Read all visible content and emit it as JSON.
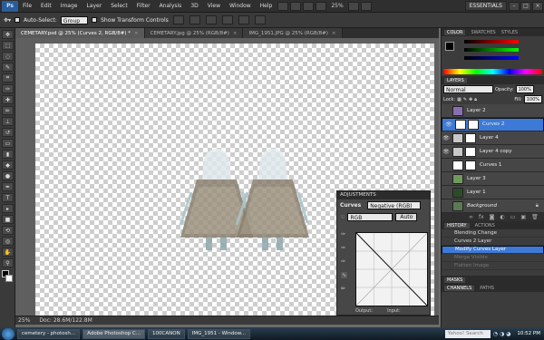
{
  "menubar": {
    "logo": "Ps",
    "items": [
      "File",
      "Edit",
      "Image",
      "Layer",
      "Select",
      "Filter",
      "Analysis",
      "3D",
      "View",
      "Window",
      "Help"
    ],
    "zoom": "25%",
    "workspace": "ESSENTIALS"
  },
  "options": {
    "auto_select_label": "Auto-Select:",
    "auto_select_value": "Group",
    "transform_label": "Show Transform Controls"
  },
  "tabs": [
    {
      "label": "CEMETARY.psd @ 25% (Curves 2, RGB/8#) *",
      "active": true
    },
    {
      "label": "CEMETARY.jpg @ 25% (RGB/8#)",
      "active": false
    },
    {
      "label": "IMG_1951.JPG @ 25% (RGB/8#)",
      "active": false
    }
  ],
  "status": {
    "zoom": "25%",
    "doc": "Doc: 28.6M/122.8M"
  },
  "adjustments": {
    "title": "ADJUSTMENTS",
    "curves_label": "Curves",
    "preset": "Negative (RGB)",
    "channel": "RGB",
    "auto": "Auto",
    "output": "Output:",
    "input": "Input:"
  },
  "panels": {
    "color_tabs": [
      "COLOR",
      "SWATCHES",
      "STYLES"
    ],
    "layers_tabs": [
      "LAYERS"
    ],
    "blend_mode": "Normal",
    "opacity_label": "Opacity:",
    "opacity": "100%",
    "lock_label": "Lock:",
    "fill_label": "Fill:",
    "fill": "100%",
    "layers": [
      {
        "name": "Layer 2",
        "visible": false,
        "selected": false,
        "thumb": "#8a6fb0",
        "mask": false
      },
      {
        "name": "Curves 2",
        "visible": true,
        "selected": true,
        "thumb": "#ffffff",
        "mask": true
      },
      {
        "name": "Layer 4",
        "visible": true,
        "selected": false,
        "thumb": "#c8c8c8",
        "mask": true
      },
      {
        "name": "Layer 4 copy",
        "visible": true,
        "selected": false,
        "thumb": "#c8c8c8",
        "mask": true
      },
      {
        "name": "Curves 1",
        "visible": false,
        "selected": false,
        "thumb": "#ffffff",
        "mask": true
      },
      {
        "name": "Layer 3",
        "visible": false,
        "selected": false,
        "thumb": "#6f9a5c",
        "mask": false
      },
      {
        "name": "Layer 1",
        "visible": false,
        "selected": false,
        "thumb": "#2e4a2a",
        "mask": false
      },
      {
        "name": "Background",
        "visible": false,
        "selected": false,
        "thumb": "#5b7a54",
        "mask": false
      }
    ],
    "history_tabs": [
      "HISTORY",
      "ACTIONS"
    ],
    "history": [
      {
        "name": "Blending Change",
        "state": "normal"
      },
      {
        "name": "Curves 2 Layer",
        "state": "normal"
      },
      {
        "name": "Modify Curves Layer",
        "state": "selected"
      },
      {
        "name": "Merge Visible",
        "state": "dim"
      },
      {
        "name": "Flatten Image",
        "state": "dim"
      }
    ],
    "bottom_tabs": [
      "MASKS"
    ],
    "bottom_tabs2": [
      "CHANNELS",
      "PATHS"
    ]
  },
  "taskbar": {
    "tasks": [
      {
        "label": "cemetery - photosh...",
        "active": false
      },
      {
        "label": "Adobe Photoshop C...",
        "active": true
      },
      {
        "label": "100CANON",
        "active": false
      },
      {
        "label": "IMG_1951 - Window...",
        "active": false
      }
    ],
    "search": "Yahoo! Search",
    "clock": "10:52 PM"
  }
}
